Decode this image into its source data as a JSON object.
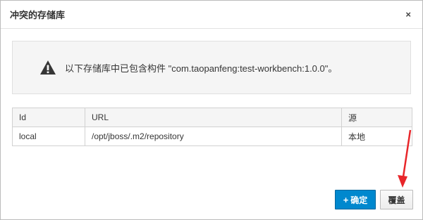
{
  "dialog": {
    "title": "冲突的存储库",
    "close_glyph": "×"
  },
  "alert": {
    "icon": "warning-triangle-icon",
    "message": "以下存储库中已包含构件 \"com.taopanfeng:test-workbench:1.0.0\"。"
  },
  "table": {
    "headers": [
      "Id",
      "URL",
      "源"
    ],
    "rows": [
      [
        "local",
        "/opt/jboss/.m2/repository",
        "本地"
      ]
    ]
  },
  "buttons": {
    "confirm_icon": "plus-icon",
    "confirm_glyph": "+",
    "confirm_label": "确定",
    "override_label": "覆盖"
  },
  "colors": {
    "primary": "#0088ce",
    "annotation_arrow": "#e8262a"
  }
}
